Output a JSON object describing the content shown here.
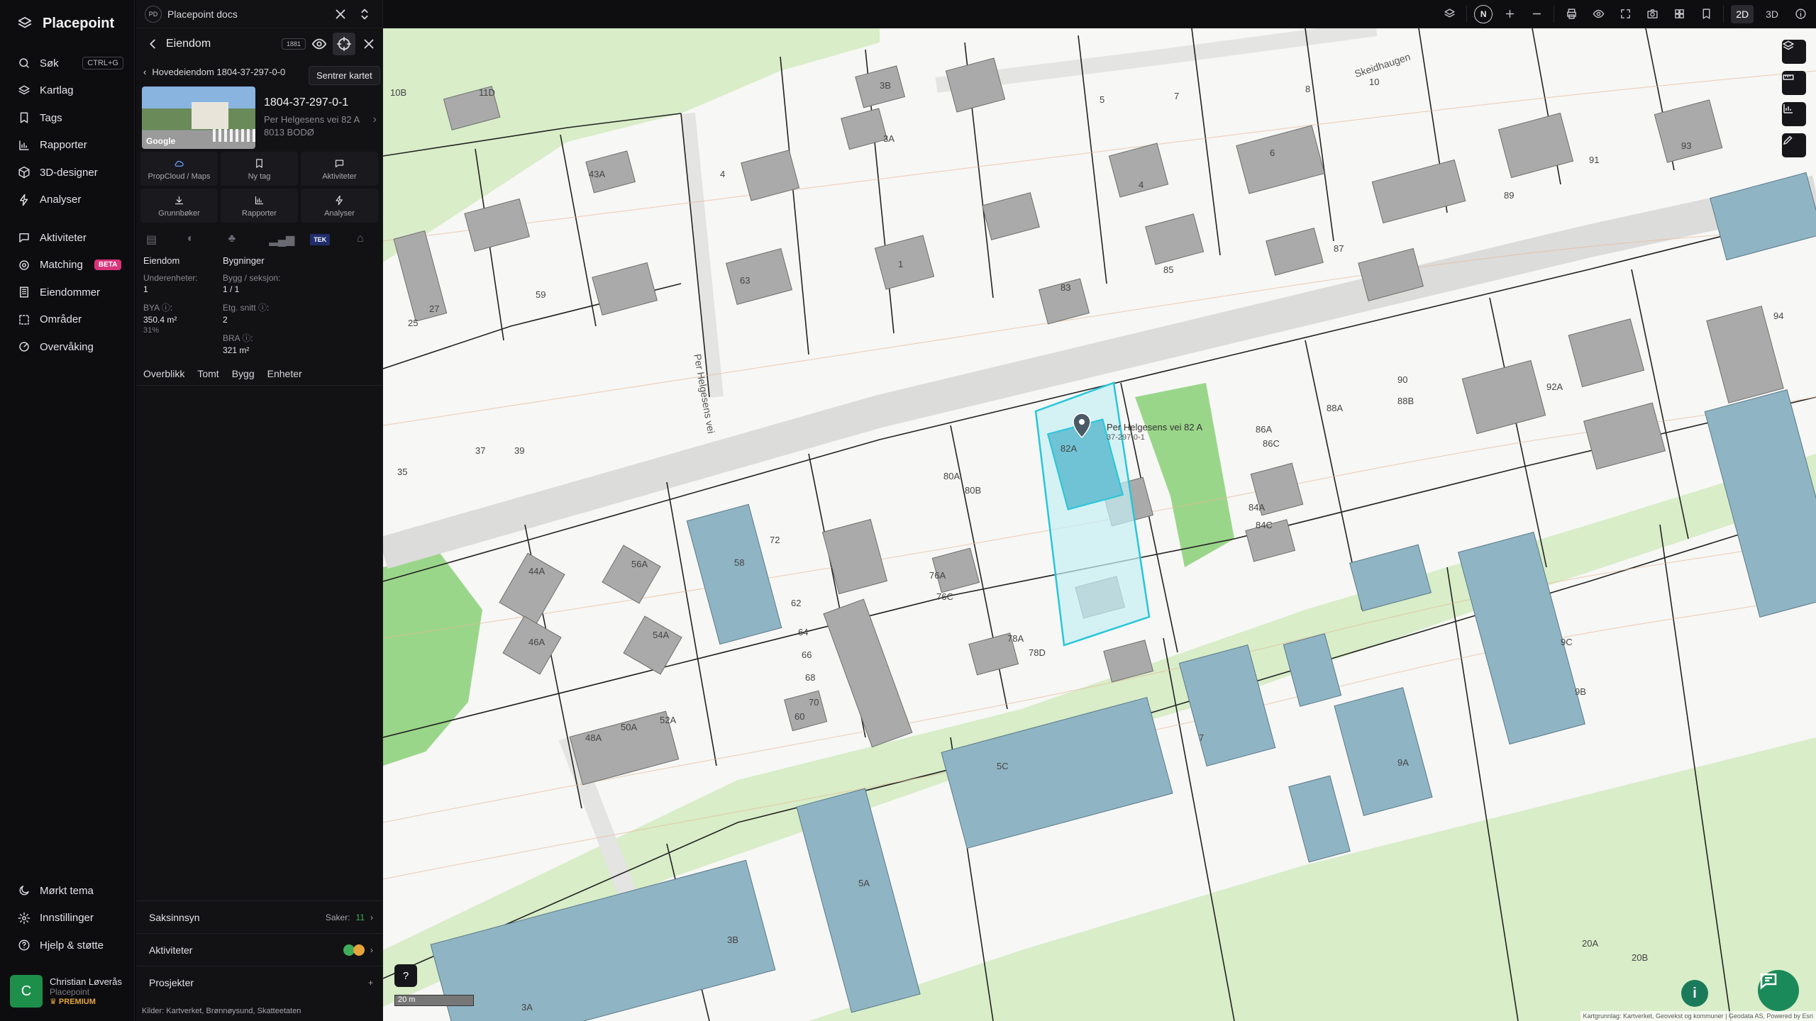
{
  "nav": {
    "brand": "Placepoint",
    "items": [
      {
        "label": "Søk",
        "shortcut": "CTRL+G",
        "icon": "search-icon"
      },
      {
        "label": "Kartlag",
        "icon": "layers-icon"
      },
      {
        "label": "Tags",
        "icon": "tag-icon"
      },
      {
        "label": "Rapporter",
        "icon": "chart-icon"
      },
      {
        "label": "3D-designer",
        "icon": "cube-icon"
      },
      {
        "label": "Analyser",
        "icon": "bolt-icon"
      }
    ],
    "items2": [
      {
        "label": "Aktiviteter",
        "icon": "chat-icon"
      },
      {
        "label": "Matching",
        "badge": "BETA",
        "icon": "target-icon"
      },
      {
        "label": "Eiendommer",
        "icon": "building-icon"
      },
      {
        "label": "Områder",
        "icon": "area-icon"
      },
      {
        "label": "Overvåking",
        "icon": "radar-icon"
      }
    ],
    "bottom": [
      {
        "label": "Mørkt tema",
        "icon": "moon-icon"
      },
      {
        "label": "Innstillinger",
        "icon": "gear-icon"
      },
      {
        "label": "Hjelp & støtte",
        "icon": "help-icon"
      }
    ],
    "user": {
      "initial": "C",
      "name": "Christian Løverås",
      "org": "Placepoint",
      "plan": "PREMIUM"
    }
  },
  "panel": {
    "workspace_badge": "PD",
    "workspace": "Placepoint docs",
    "title": "Eiendom",
    "badge_1881": "1881",
    "tooltip": "Sentrer kartet",
    "breadcrumb": "Hovedeiendom 1804-37-297-0-0",
    "photo_brand": "Google",
    "property_id": "1804-37-297-0-1",
    "address_line1": "Per Helgesens vei 82 A",
    "address_line2": "8013 BODØ",
    "actions": [
      {
        "label": "PropCloud / Maps",
        "icon": "cloud-icon"
      },
      {
        "label": "Ny tag",
        "icon": "bookmark-icon"
      },
      {
        "label": "Aktiviteter",
        "icon": "comment-icon"
      },
      {
        "label": "Grunnbøker",
        "icon": "download-icon"
      },
      {
        "label": "Rapporter",
        "icon": "chart-icon"
      },
      {
        "label": "Analyser",
        "icon": "bolt-icon"
      }
    ],
    "tek_label": "TEK",
    "stats": {
      "col1_title": "Eiendom",
      "col2_title": "Bygninger",
      "units_label": "Underenheter:",
      "units_value": "1",
      "bygg_label": "Bygg / seksjon:",
      "bygg_value": "1 / 1",
      "bya_label": "BYA ⓘ:",
      "bya_value": "350.4 m²",
      "bya_pct": "31%",
      "etg_label": "Etg. snitt ⓘ:",
      "etg_value": "2",
      "bra_label": "BRA ⓘ:",
      "bra_value": "321 m²"
    },
    "tabs": [
      "Overblikk",
      "Tomt",
      "Bygg",
      "Enheter"
    ],
    "saksinnsyn": {
      "label": "Saksinnsyn",
      "cases_label": "Saker:",
      "cases_count": "11"
    },
    "aktiviteter_label": "Aktiviteter",
    "prosjekter_label": "Prosjekter",
    "sources_label": "Kilder:",
    "sources": [
      "Kartverket,",
      "Brønnøysund,",
      "Skatteetaten"
    ]
  },
  "topbar": {
    "compass": "N",
    "mode_2d": "2D",
    "mode_3d": "3D"
  },
  "map": {
    "street_1": "Per Helgesens vei",
    "street_2": "Skeidhaugen",
    "marker_label": "Per Helgesens vei 82 A",
    "marker_sub": "37-297-0-1",
    "scale": "20 m",
    "attribution": "Kartgrunnlag: Kartverket, Geovekst og kommuner | Geodata AS, Powered by Esri",
    "accent": "#27c6d9",
    "building_blue": "#8fb4c4",
    "building_grey": "#a9aaa9",
    "green": "#9ad68a"
  }
}
